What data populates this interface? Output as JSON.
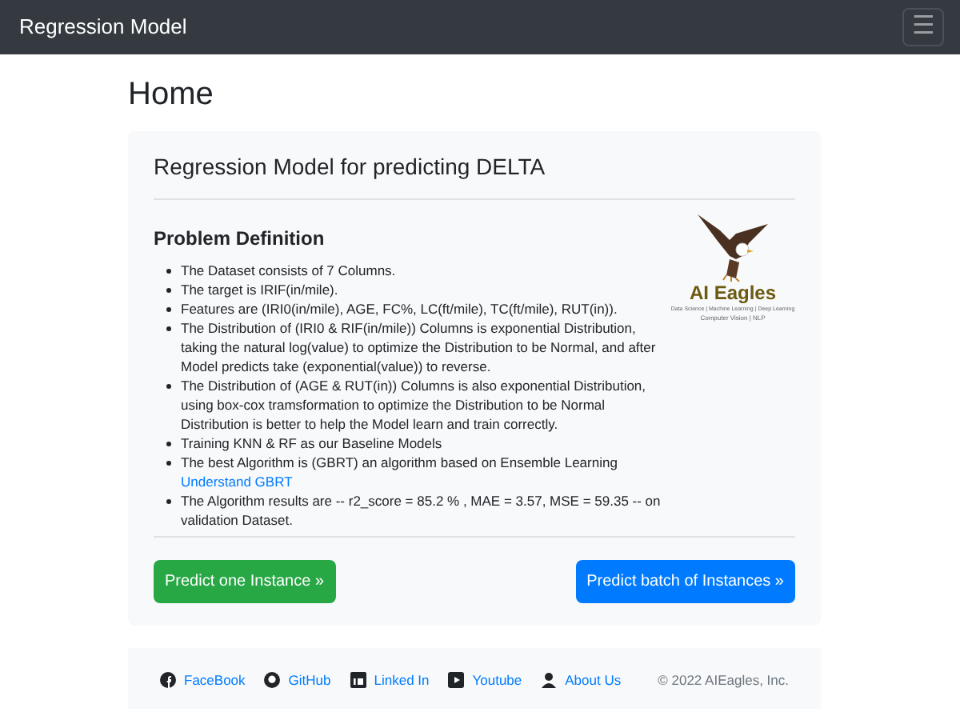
{
  "navbar": {
    "brand": "Regression Model",
    "menu_icon": "☰"
  },
  "page_title": "Home",
  "card": {
    "title": "Regression Model for predicting DELTA",
    "section_title": "Problem Definition",
    "items": [
      {
        "text": "The Dataset consists of 7 Columns."
      },
      {
        "text": "The target is IRIF(in/mile)."
      },
      {
        "text": "Features are (IRI0(in/mile), AGE, FC%, LC(ft/mile), TC(ft/mile), RUT(in))."
      },
      {
        "text": "The Distribution of (IRI0 & RIF(in/mile)) Columns is exponential Distribution, taking the natural log(value) to optimize the Distribution to be Normal, and after Model predicts take (exponential(value)) to reverse."
      },
      {
        "text": "The Distribution of (AGE & RUT(in)) Columns is also exponential Distribution, using box-cox tramsformation to optimize the Distribution to be Normal Distribution is better to help the Model learn and train correctly."
      },
      {
        "text": "Training KNN & RF as our Baseline Models"
      },
      {
        "text": "The best Algorithm is (GBRT) an algorithm based on Ensemble Learning",
        "link": "Understand GBRT"
      },
      {
        "text": "The Algorithm results are -- r2_score = 85.2 % , MAE = 3.57, MSE = 59.35 -- on validation Dataset."
      }
    ],
    "logo": {
      "name": "AI Eagles",
      "tagline_1": "Data Science | Machine Learning | Deep Learning",
      "tagline_2": "Computer Vision | NLP"
    },
    "buttons": [
      {
        "label": "Predict one Instance »",
        "kind": "success"
      },
      {
        "label": "Predict batch of Instances »",
        "kind": "primary"
      }
    ]
  },
  "footer": {
    "links": [
      {
        "label": "FaceBook",
        "kind": "facebook"
      },
      {
        "label": "GitHub",
        "kind": "github"
      },
      {
        "label": "Linked In",
        "kind": "linkedin"
      },
      {
        "label": "Youtube",
        "kind": "youtube"
      },
      {
        "label": "About Us",
        "kind": "user"
      }
    ],
    "copyright": "© 2022 AIEagles, Inc."
  }
}
